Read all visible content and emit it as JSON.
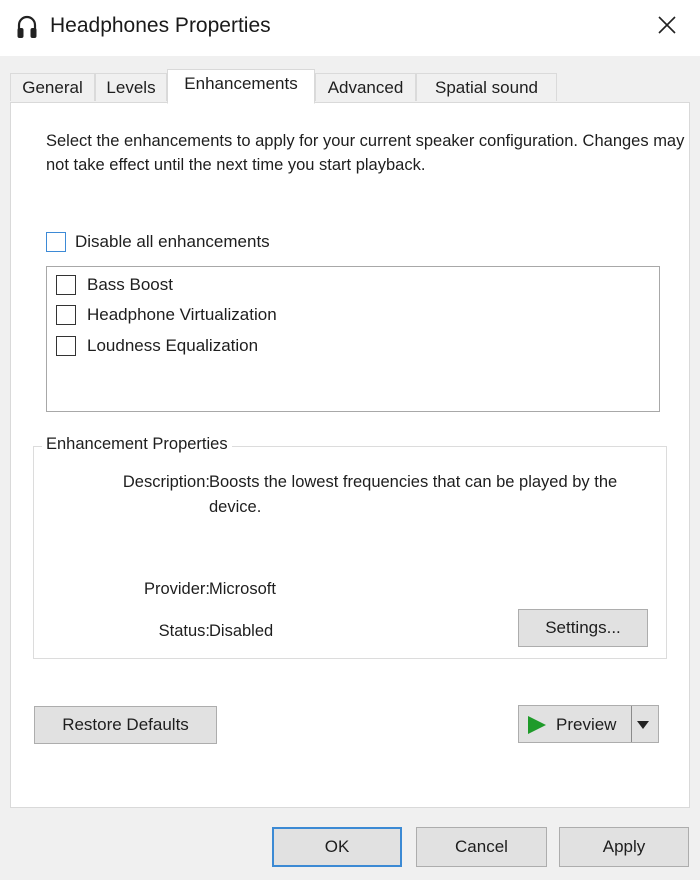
{
  "window": {
    "title": "Headphones Properties",
    "icon": "headphones-icon",
    "close_icon": "close-icon"
  },
  "tabs": [
    {
      "label": "General",
      "active": false
    },
    {
      "label": "Levels",
      "active": false
    },
    {
      "label": "Enhancements",
      "active": true
    },
    {
      "label": "Advanced",
      "active": false
    },
    {
      "label": "Spatial sound",
      "active": false
    }
  ],
  "enhancements": {
    "intro_text": "Select the enhancements to apply for your current speaker configuration. Changes may not take effect until the next time you start playback.",
    "disable_all_label": "Disable all enhancements",
    "disable_all_checked": false,
    "items": [
      {
        "label": "Bass Boost",
        "checked": false
      },
      {
        "label": "Headphone Virtualization",
        "checked": false
      },
      {
        "label": "Loudness Equalization",
        "checked": false
      }
    ]
  },
  "properties": {
    "legend": "Enhancement Properties",
    "description_label": "Description:",
    "description_value": "Boosts the lowest frequencies that can be played by the device.",
    "provider_label": "Provider:",
    "provider_value": "Microsoft",
    "status_label": "Status:",
    "status_value": "Disabled",
    "settings_button": "Settings..."
  },
  "actions": {
    "restore_defaults": "Restore Defaults",
    "preview": "Preview",
    "preview_icon": "play-icon",
    "preview_dropdown_icon": "chevron-down-icon"
  },
  "footer": {
    "ok": "OK",
    "cancel": "Cancel",
    "apply": "Apply"
  },
  "colors": {
    "accent": "#3c8ad4",
    "play_green": "#1f9b2a",
    "dialog_bg": "#f0f0f0",
    "panel_bg": "#ffffff",
    "button_bg": "#e1e1e1"
  }
}
